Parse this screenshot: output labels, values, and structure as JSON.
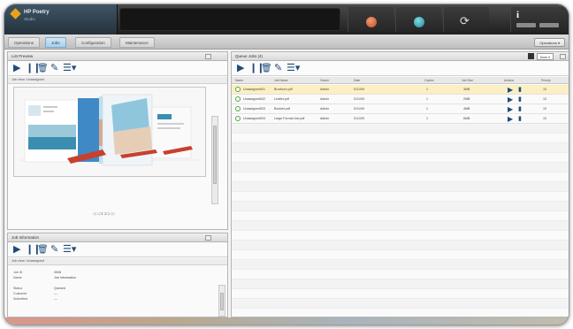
{
  "app": {
    "title": "HP Poetry",
    "subtitle": "Studio"
  },
  "topbar": {
    "status_labels": [
      "",
      "",
      ""
    ],
    "user_label": "i"
  },
  "tabs": [
    {
      "label": "Operations",
      "active": false
    },
    {
      "label": "Jobs",
      "active": true
    },
    {
      "label": "Configuration",
      "active": false
    },
    {
      "label": "Maintenance",
      "active": false
    }
  ],
  "tabbar": {
    "right_button": "Operations ▾"
  },
  "left_panel": {
    "title": "List Preview",
    "subheader": "Job view: Unassigned",
    "pager": "◁ ◁ 1 2 ▷ ▷"
  },
  "properties_panel": {
    "title": "Job Information",
    "subheader": "Job view: Unassigned",
    "rows": [
      {
        "k": "Job ID",
        "v": "0008"
      },
      {
        "k": "Name",
        "v": "Job Information"
      },
      {
        "k": "Status",
        "v": "Queued"
      },
      {
        "k": "Customer",
        "v": "—"
      },
      {
        "k": "Submitted",
        "v": "—"
      }
    ]
  },
  "right_panel": {
    "title": "Queue Jobs (4)",
    "dropdown": "Done ▾",
    "columns": [
      "Name",
      "Job Name",
      "Owner",
      "Date",
      "Copies",
      "Job Size",
      "Actions",
      "Priority"
    ],
    "rows": [
      {
        "name": "Unassigned001",
        "job": "Brochure.pdf",
        "owner": "Admin",
        "date": "01/1/09",
        "copies": "1",
        "size": "3MB",
        "priority": "10",
        "highlight": true
      },
      {
        "name": "Unassigned002",
        "job": "Leaflet.pdf",
        "owner": "Admin",
        "date": "01/1/09",
        "copies": "1",
        "size": "2MB",
        "priority": "10",
        "highlight": false
      },
      {
        "name": "Unassigned003",
        "job": "Booklet.pdf",
        "owner": "Admin",
        "date": "01/1/09",
        "copies": "1",
        "size": "4MB",
        "priority": "10",
        "highlight": false
      },
      {
        "name": "Unassigned004",
        "job": "Large Format Job.pdf",
        "owner": "Admin",
        "date": "01/1/09",
        "copies": "1",
        "size": "6MB",
        "priority": "10",
        "highlight": false
      }
    ]
  },
  "toolbar_icons": [
    "play-icon",
    "pause-icon",
    "trash-icon",
    "edit-icon",
    "list-menu-icon"
  ],
  "colors": {
    "accent_blue": "#1e4c7a",
    "highlight_row": "#fcefc2",
    "status_red": "#c0501f",
    "status_teal": "#1b8c98",
    "active_tab": "#a9d0ec"
  }
}
